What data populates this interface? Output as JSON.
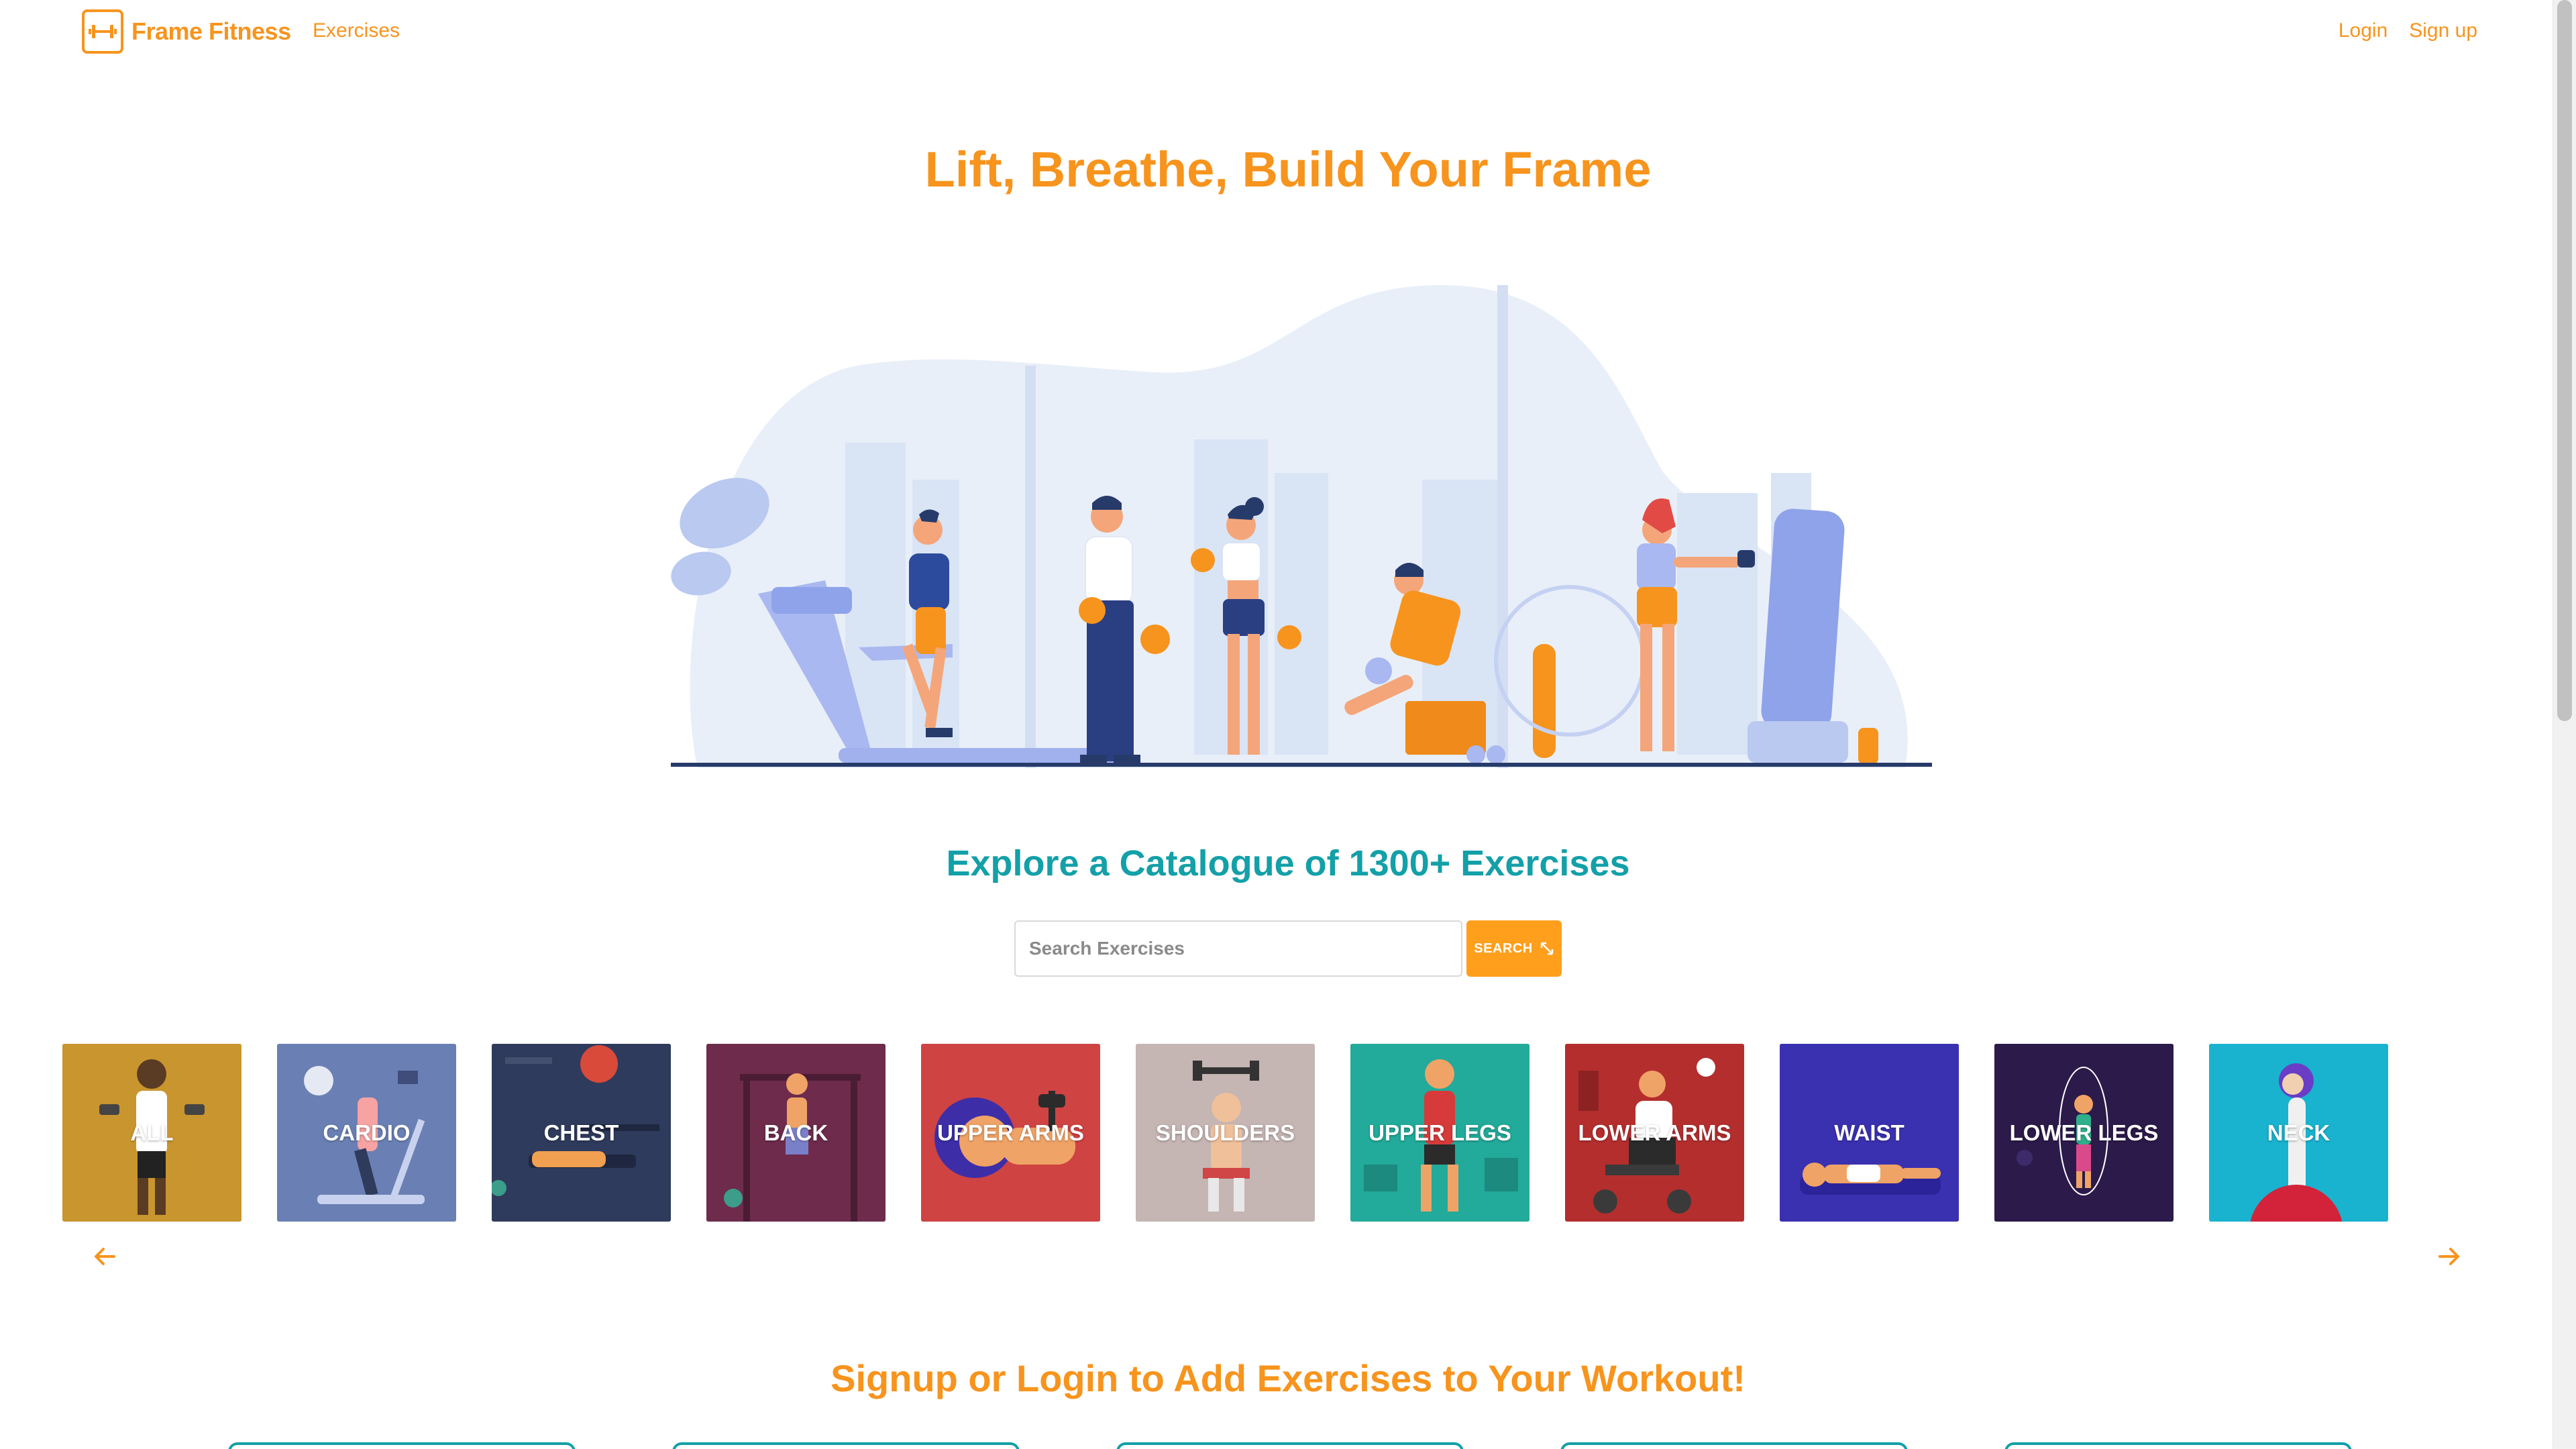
{
  "nav": {
    "brand": "Frame Fitness",
    "exercises_link": "Exercises",
    "login": "Login",
    "signup": "Sign up"
  },
  "hero": {
    "title": "Lift, Breathe, Build Your Frame"
  },
  "explore": {
    "title": "Explore a Catalogue of 1300+ Exercises",
    "search_placeholder": "Search Exercises",
    "search_button": "SEARCH"
  },
  "categories": [
    {
      "label": "ALL",
      "color": "#c9952e"
    },
    {
      "label": "CARDIO",
      "color": "#6a80b4"
    },
    {
      "label": "CHEST",
      "color": "#2f3b5c"
    },
    {
      "label": "BACK",
      "color": "#6e2b4c"
    },
    {
      "label": "UPPER ARMS",
      "color": "#cf4343"
    },
    {
      "label": "SHOULDERS",
      "color": "#c5b5b3"
    },
    {
      "label": "UPPER LEGS",
      "color": "#22aa9a"
    },
    {
      "label": "LOWER ARMS",
      "color": "#b42e2e"
    },
    {
      "label": "WAIST",
      "color": "#3a31b0"
    },
    {
      "label": "LOWER LEGS",
      "color": "#2c1a4a"
    },
    {
      "label": "NECK",
      "color": "#19b3cf"
    }
  ],
  "signup": {
    "title": "Signup or Login to Add Exercises to Your Workout!"
  },
  "colors": {
    "accent": "#f7941d",
    "teal": "#13a0a8"
  }
}
